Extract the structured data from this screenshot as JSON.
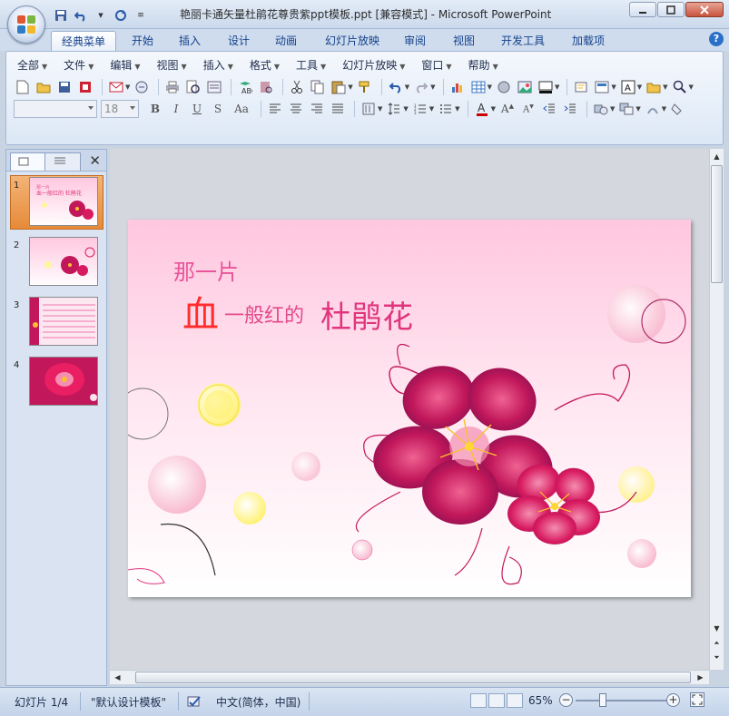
{
  "window": {
    "title": "艳丽卡通矢量杜鹃花尊贵紫ppt模板.ppt [兼容模式] - Microsoft PowerPoint",
    "controls": [
      "minimize",
      "maximize",
      "close"
    ]
  },
  "ribbon_tabs": [
    "经典菜单",
    "开始",
    "插入",
    "设计",
    "动画",
    "幻灯片放映",
    "审阅",
    "视图",
    "开发工具",
    "加载项"
  ],
  "active_tab": "经典菜单",
  "classic_menu": [
    "全部",
    "文件",
    "编辑",
    "视图",
    "插入",
    "格式",
    "工具",
    "幻灯片放映",
    "窗口",
    "帮助"
  ],
  "format_toolbar": {
    "font_name": "",
    "font_size": "18"
  },
  "slides_panel": {
    "thumb_numbers": [
      "1",
      "2",
      "3",
      "4"
    ],
    "selected": 1
  },
  "slide": {
    "line1": "那一片",
    "big_char": "血",
    "line2": "一般红的",
    "flower_name": "杜鹃花"
  },
  "status_bar": {
    "slide_info": "幻灯片 1/4",
    "theme": "\"默认设计模板\"",
    "language": "中文(简体，中国)",
    "zoom": "65%"
  },
  "colors": {
    "accent_pink": "#e0357d",
    "accent_red": "#ff2d2d",
    "flower_magenta": "#c2185b",
    "ribbon_bg": "#dde8f6"
  }
}
